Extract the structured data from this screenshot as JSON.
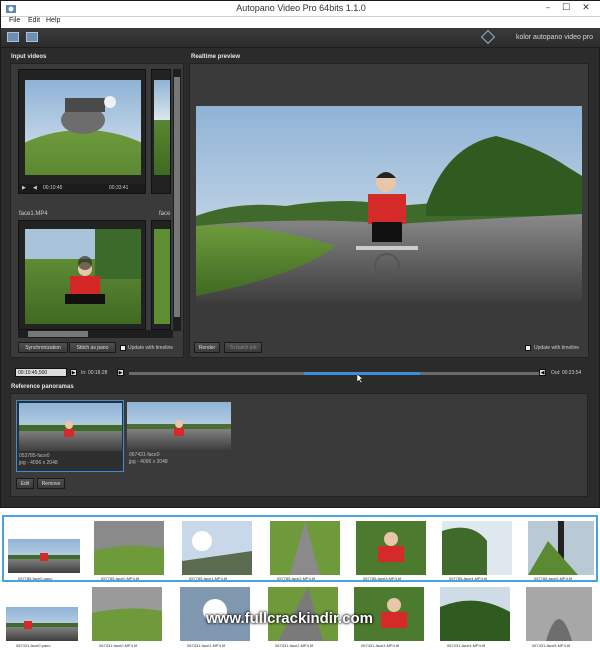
{
  "window": {
    "title": "Autopano Video Pro 64bits 1.1.0",
    "minimize": "–",
    "maximize": "☐",
    "close": "✕"
  },
  "menu": {
    "items": [
      "File",
      "Edit",
      "Help"
    ]
  },
  "toolbar": {
    "brand": "kolor autopano video pro",
    "icons": [
      "import-video-icon",
      "export-icon"
    ]
  },
  "input_videos": {
    "label": "Input videos",
    "videos": [
      {
        "label": "",
        "time_start": "00:10:45",
        "time_end": "00:33:41"
      },
      {
        "label": "face1.MP4",
        "time_start": "",
        "time_end": ""
      }
    ],
    "side_label": "face",
    "sync_button": "Synchronization",
    "stitch_button": "Stitch as pano",
    "update_label": "Update with timeline"
  },
  "preview": {
    "label": "Realtime preview",
    "render_button": "Render",
    "batch_button": "To batch job",
    "update_label": "Update with timeline"
  },
  "timeline": {
    "in_time": "00:10:45,500",
    "in_label": "In: 00:18:28",
    "out_label": "Out: 00:23:54",
    "selection_start": 0.42,
    "selection_end": 0.7
  },
  "reference": {
    "label": "Reference panoramas",
    "items": [
      {
        "name": "053785-face0",
        "meta": "jpg - 4096 x 2048"
      },
      {
        "name": "067431-face0",
        "meta": "jpg - 4096 x 2048"
      }
    ],
    "edit_button": "Edit",
    "remove_button": "Remove"
  },
  "filmstrip_top": {
    "captions": [
      "057785-face0.pano",
      "057785-face0.MP4.tif",
      "057785-face1.MP4.tif",
      "057785-face2.MP4.tif",
      "057785-face3.MP4.tif",
      "057785-face4.MP4.tif",
      "057785-face5.MP4.tif"
    ]
  },
  "filmstrip_bottom": {
    "captions": [
      "067431-face0.pano",
      "067431-face0.MP4.tif",
      "067431-face1.MP4.tif",
      "067431-face2.MP4.tif",
      "067431-face3.MP4.tif",
      "067431-face4.MP4.tif",
      "067431-face5.MP4.tif"
    ]
  },
  "watermark": "www.fullcrackindir.com"
}
